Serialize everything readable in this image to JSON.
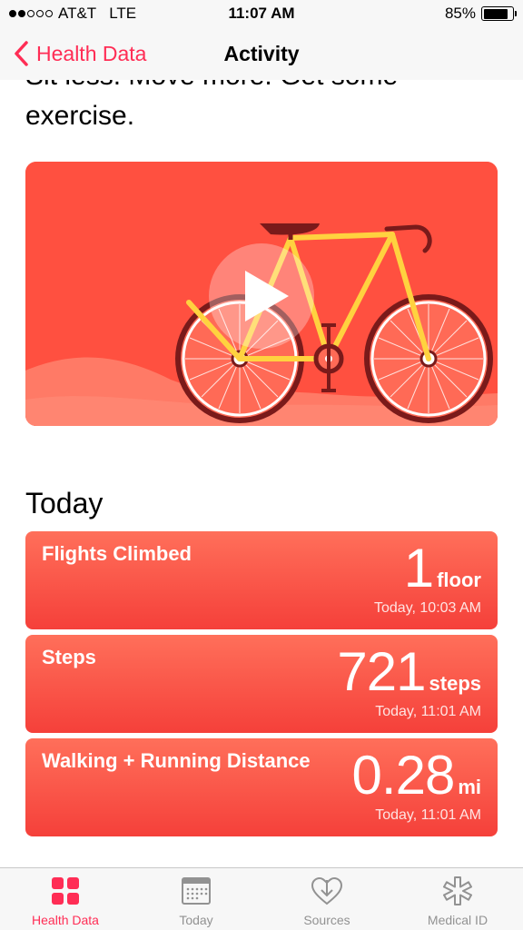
{
  "status": {
    "carrier": "AT&T",
    "network": "LTE",
    "time": "11:07 AM",
    "battery": "85%",
    "battery_level": 0.85
  },
  "nav": {
    "back_label": "Health Data",
    "title": "Activity"
  },
  "intro": {
    "text": "Sit less. Move more. Get some exercise."
  },
  "video": {
    "icon": "play-icon"
  },
  "today": {
    "title": "Today",
    "metrics": [
      {
        "name": "Flights Climbed",
        "value": "1",
        "unit": "floor",
        "time": "Today, 10:03 AM"
      },
      {
        "name": "Steps",
        "value": "721",
        "unit": "steps",
        "time": "Today, 11:01 AM"
      },
      {
        "name": "Walking + Running Distance",
        "value": "0.28",
        "unit": "mi",
        "time": "Today, 11:01 AM"
      }
    ]
  },
  "tabs": [
    {
      "label": "Health Data",
      "icon": "grid-icon",
      "active": true
    },
    {
      "label": "Today",
      "icon": "calendar-icon",
      "active": false
    },
    {
      "label": "Sources",
      "icon": "heart-download-icon",
      "active": false
    },
    {
      "label": "Medical ID",
      "icon": "medical-star-icon",
      "active": false
    }
  ],
  "colors": {
    "accent": "#ff2d55",
    "card": "#f5403a",
    "video_bg": "#ff5040"
  }
}
